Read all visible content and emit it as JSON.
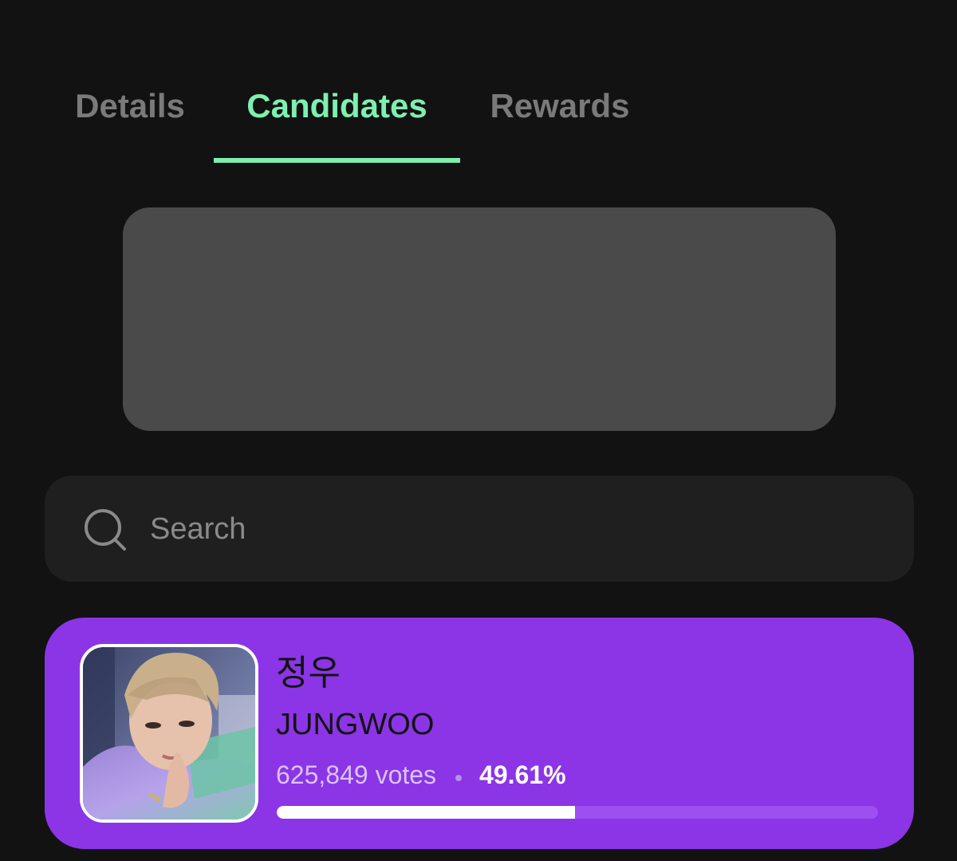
{
  "tabs": [
    {
      "label": "Details",
      "active": false
    },
    {
      "label": "Candidates",
      "active": true
    },
    {
      "label": "Rewards",
      "active": false
    }
  ],
  "colors": {
    "background": "#121212",
    "accent": "#7ef0b0",
    "tab_inactive": "#7a7a7a",
    "banner": "#4a4a4a",
    "search_bg": "#1f1f1f",
    "card": "#8b35e6"
  },
  "search": {
    "placeholder": "Search",
    "value": "",
    "icon": "search-icon"
  },
  "candidates": [
    {
      "name_ko": "정우",
      "name_en": "JUNGWOO",
      "votes": "625,849 votes",
      "percent": "49.61%",
      "progress": 0.4961
    }
  ]
}
